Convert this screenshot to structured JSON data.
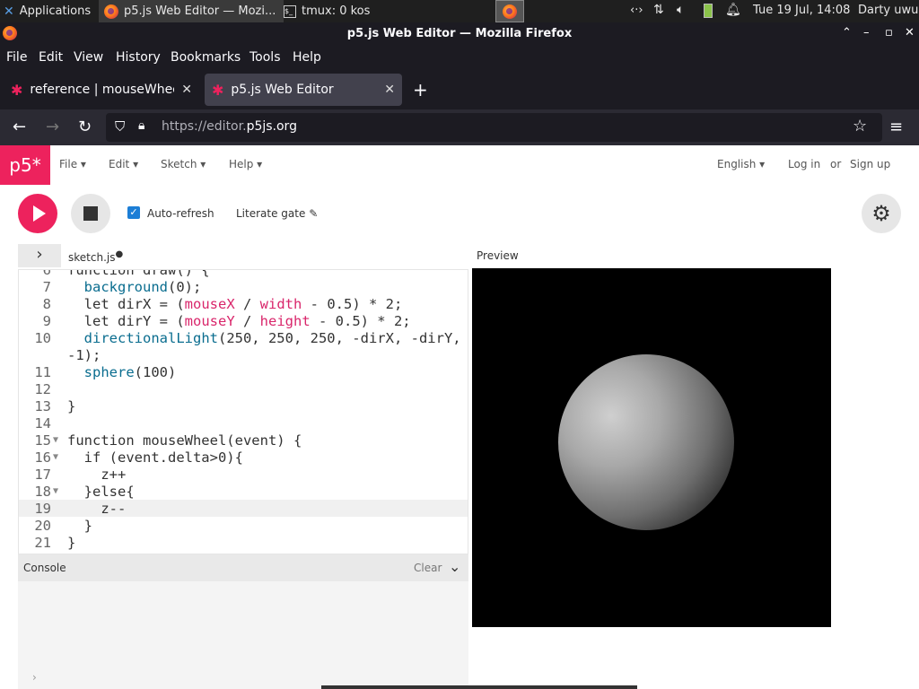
{
  "panel": {
    "applications": "Applications",
    "tasks": [
      {
        "label": "p5.js Web Editor — Mozi..."
      },
      {
        "label": "tmux: 0 kos"
      }
    ],
    "clock": "Tue 19 Jul, 14:08",
    "user": "Darty uwu"
  },
  "window": {
    "title": "p5.js Web Editor — Mozilla Firefox"
  },
  "menubar": {
    "items": [
      "File",
      "Edit",
      "View",
      "History",
      "Bookmarks",
      "Tools",
      "Help"
    ]
  },
  "tabs": [
    {
      "label": "reference | mouseWheel("
    },
    {
      "label": "p5.js Web Editor"
    }
  ],
  "nav": {
    "url_prefix": "https://editor.",
    "url_domain": "p5js.org"
  },
  "p5": {
    "logo": "p5*",
    "menus": [
      "File",
      "Edit",
      "Sketch",
      "Help"
    ],
    "language": "English",
    "login": "Log in",
    "or": "or",
    "signup": "Sign up",
    "autorefresh": "Auto-refresh",
    "sketch_name": "Literate gate",
    "filename": "sketch.js",
    "preview_label": "Preview",
    "console_label": "Console",
    "console_clear": "Clear"
  },
  "code": {
    "lines": [
      {
        "n": "6",
        "text": "function draw() {"
      },
      {
        "n": "7",
        "text": "  background(0);"
      },
      {
        "n": "8",
        "text": "  let dirX = (mouseX / width - 0.5) * 2;"
      },
      {
        "n": "9",
        "text": "  let dirY = (mouseY / height - 0.5) * 2;"
      },
      {
        "n": "10",
        "text": "  directionalLight(250, 250, 250, -dirX, -dirY,"
      },
      {
        "n": "",
        "text": "-1);"
      },
      {
        "n": "11",
        "text": "  sphere(100)"
      },
      {
        "n": "12",
        "text": ""
      },
      {
        "n": "13",
        "text": "}"
      },
      {
        "n": "14",
        "text": ""
      },
      {
        "n": "15",
        "text": "function mouseWheel(event) {"
      },
      {
        "n": "16",
        "text": "  if (event.delta>0){"
      },
      {
        "n": "17",
        "text": "    z++"
      },
      {
        "n": "18",
        "text": "  }else{"
      },
      {
        "n": "19",
        "text": "    z--"
      },
      {
        "n": "20",
        "text": "  }"
      },
      {
        "n": "21",
        "text": "}"
      }
    ]
  }
}
